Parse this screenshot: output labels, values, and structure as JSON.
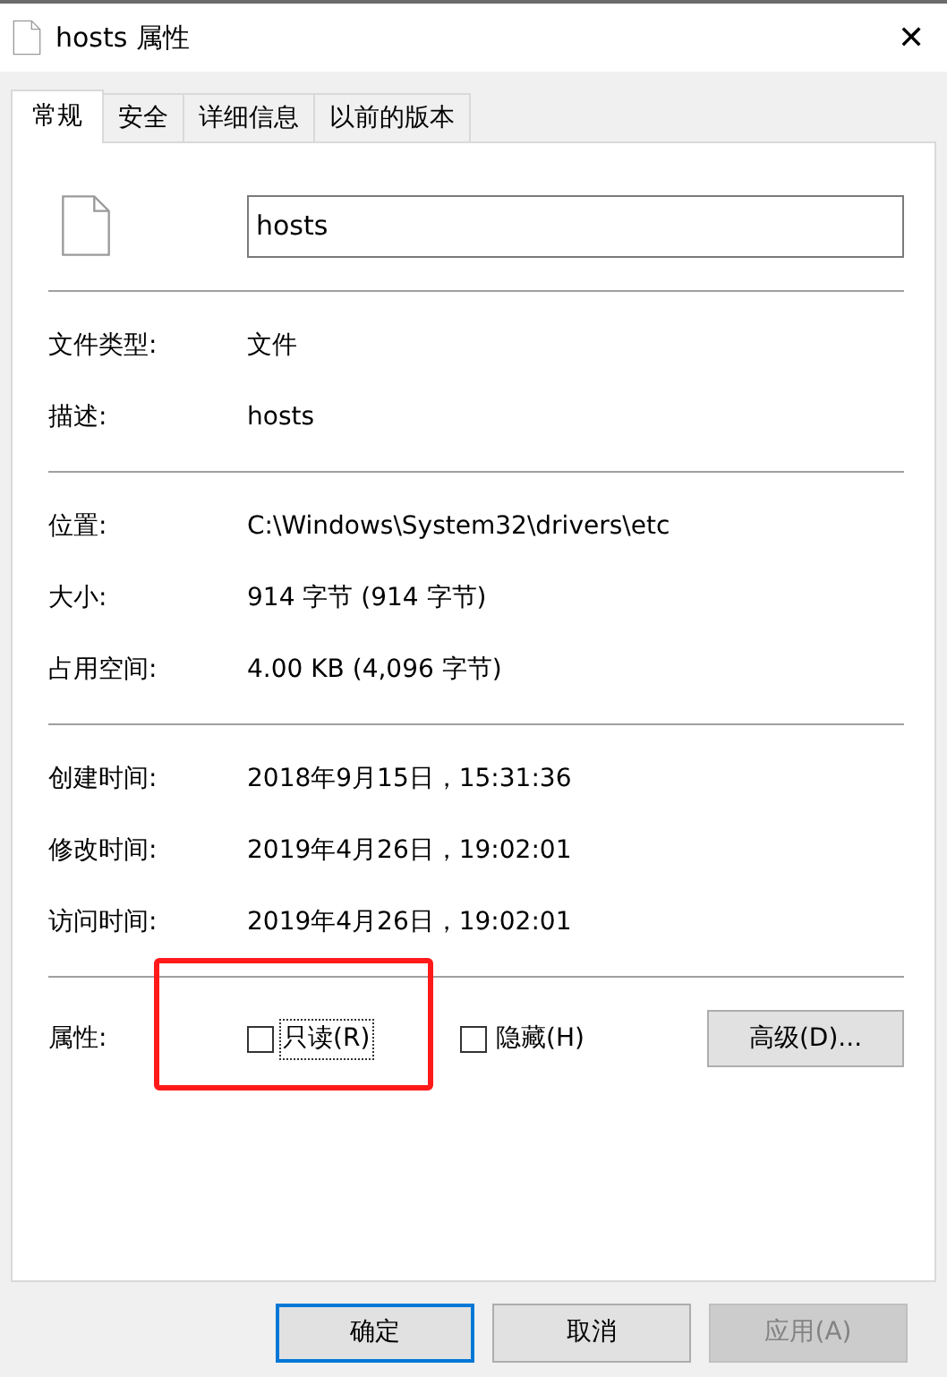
{
  "window": {
    "title": "hosts 属性",
    "close": "✕"
  },
  "tabs": [
    {
      "label": "常规",
      "selected": true
    },
    {
      "label": "安全",
      "selected": false
    },
    {
      "label": "详细信息",
      "selected": false
    },
    {
      "label": "以前的版本",
      "selected": false
    }
  ],
  "file_name": "hosts",
  "sections": [
    [
      {
        "label": "文件类型:",
        "value": "文件"
      },
      {
        "label": "描述:",
        "value": "hosts"
      }
    ],
    [
      {
        "label": "位置:",
        "value": "C:\\Windows\\System32\\drivers\\etc"
      },
      {
        "label": "大小:",
        "value": "914 字节 (914 字节)"
      },
      {
        "label": "占用空间:",
        "value": "4.00 KB (4,096 字节)"
      }
    ],
    [
      {
        "label": "创建时间:",
        "value": "2018年9月15日，15:31:36"
      },
      {
        "label": "修改时间:",
        "value": "2019年4月26日，19:02:01"
      },
      {
        "label": "访问时间:",
        "value": "2019年4月26日，19:02:01"
      }
    ]
  ],
  "attributes": {
    "label": "属性:",
    "items": [
      {
        "label": "只读(R)",
        "checked": false,
        "focused": true,
        "highlighted": true
      },
      {
        "label": "隐藏(H)",
        "checked": false,
        "focused": false,
        "highlighted": false
      }
    ],
    "advanced_button": "高级(D)..."
  },
  "buttons": [
    {
      "label": "确定",
      "default": true,
      "disabled": false
    },
    {
      "label": "取消",
      "default": false,
      "disabled": false
    },
    {
      "label": "应用(A)",
      "default": false,
      "disabled": true
    }
  ]
}
